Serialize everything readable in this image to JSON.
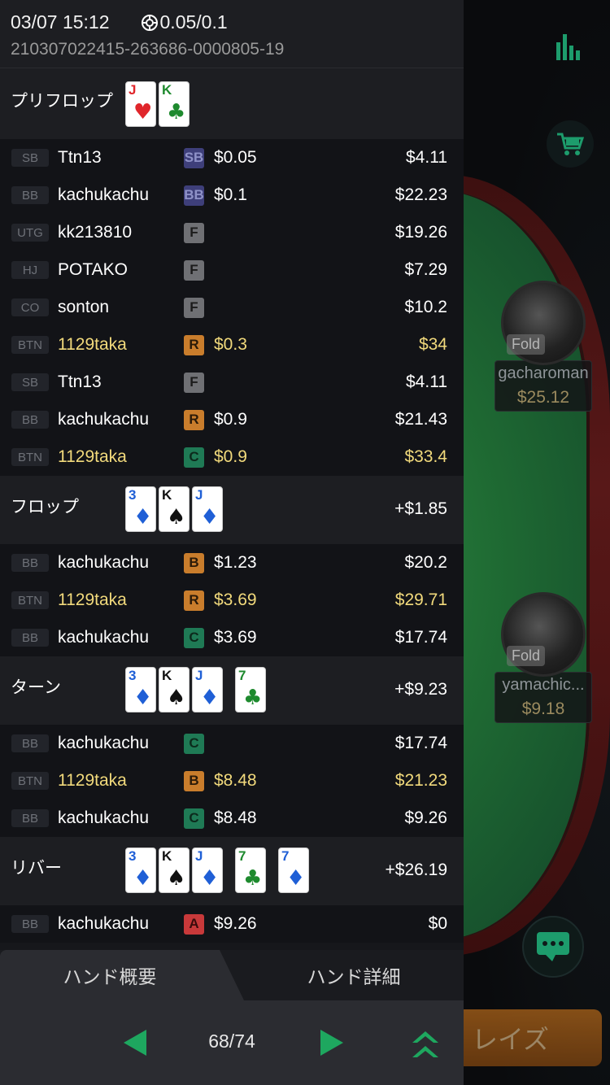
{
  "header": {
    "datetime": "03/07 15:12",
    "blinds": "0.05/0.1",
    "hand_id": "210307022415-263686-0000805-19"
  },
  "preflop": {
    "title": "プリフロップ",
    "cards": [
      {
        "rank": "J",
        "suit": "♥",
        "color": "#e0262b"
      },
      {
        "rank": "K",
        "suit": "♣",
        "color": "#1e8a2e"
      }
    ],
    "rows": [
      {
        "pos": "SB",
        "name": "Ttn13",
        "act": "SB",
        "amount": "$0.05",
        "stack": "$4.11",
        "hero": false
      },
      {
        "pos": "BB",
        "name": "kachukachu",
        "act": "BB",
        "amount": "$0.1",
        "stack": "$22.23",
        "hero": false
      },
      {
        "pos": "UTG",
        "name": "kk213810",
        "act": "F",
        "amount": "",
        "stack": "$19.26",
        "hero": false
      },
      {
        "pos": "HJ",
        "name": "POTAKO",
        "act": "F",
        "amount": "",
        "stack": "$7.29",
        "hero": false
      },
      {
        "pos": "CO",
        "name": "sonton",
        "act": "F",
        "amount": "",
        "stack": "$10.2",
        "hero": false
      },
      {
        "pos": "BTN",
        "name": "1129taka",
        "act": "R",
        "amount": "$0.3",
        "stack": "$34",
        "hero": true
      },
      {
        "pos": "SB",
        "name": "Ttn13",
        "act": "F",
        "amount": "",
        "stack": "$4.11",
        "hero": false
      },
      {
        "pos": "BB",
        "name": "kachukachu",
        "act": "R",
        "amount": "$0.9",
        "stack": "$21.43",
        "hero": false
      },
      {
        "pos": "BTN",
        "name": "1129taka",
        "act": "C",
        "amount": "$0.9",
        "stack": "$33.4",
        "hero": true
      }
    ]
  },
  "flop": {
    "title": "フロップ",
    "pot": "+$1.85",
    "cards": [
      {
        "rank": "3",
        "suit": "♦",
        "color": "#1f5fd6"
      },
      {
        "rank": "K",
        "suit": "♠",
        "color": "#111111"
      },
      {
        "rank": "J",
        "suit": "♦",
        "color": "#1f5fd6"
      }
    ],
    "rows": [
      {
        "pos": "BB",
        "name": "kachukachu",
        "act": "B",
        "amount": "$1.23",
        "stack": "$20.2",
        "hero": false
      },
      {
        "pos": "BTN",
        "name": "1129taka",
        "act": "R",
        "amount": "$3.69",
        "stack": "$29.71",
        "hero": true
      },
      {
        "pos": "BB",
        "name": "kachukachu",
        "act": "C",
        "amount": "$3.69",
        "stack": "$17.74",
        "hero": false
      }
    ]
  },
  "turn": {
    "title": "ターン",
    "pot": "+$9.23",
    "cards": [
      {
        "rank": "3",
        "suit": "♦",
        "color": "#1f5fd6"
      },
      {
        "rank": "K",
        "suit": "♠",
        "color": "#111111"
      },
      {
        "rank": "J",
        "suit": "♦",
        "color": "#1f5fd6"
      },
      {
        "rank": "7",
        "suit": "♣",
        "color": "#1e8a2e"
      }
    ],
    "rows": [
      {
        "pos": "BB",
        "name": "kachukachu",
        "act": "C",
        "amount": "",
        "stack": "$17.74",
        "hero": false
      },
      {
        "pos": "BTN",
        "name": "1129taka",
        "act": "B",
        "amount": "$8.48",
        "stack": "$21.23",
        "hero": true
      },
      {
        "pos": "BB",
        "name": "kachukachu",
        "act": "C",
        "amount": "$8.48",
        "stack": "$9.26",
        "hero": false
      }
    ]
  },
  "river": {
    "title": "リバー",
    "pot": "+$26.19",
    "cards": [
      {
        "rank": "3",
        "suit": "♦",
        "color": "#1f5fd6"
      },
      {
        "rank": "K",
        "suit": "♠",
        "color": "#111111"
      },
      {
        "rank": "J",
        "suit": "♦",
        "color": "#1f5fd6"
      },
      {
        "rank": "7",
        "suit": "♣",
        "color": "#1e8a2e"
      },
      {
        "rank": "7",
        "suit": "♦",
        "color": "#1f5fd6"
      }
    ],
    "rows": [
      {
        "pos": "BB",
        "name": "kachukachu",
        "act": "A",
        "amount": "$9.26",
        "stack": "$0",
        "hero": false
      }
    ]
  },
  "action_colors": {
    "SB": "#3e3f7a",
    "BB": "#3e3f7a",
    "F": "#6f7074",
    "R": "#c97d2c",
    "C": "#1f7a55",
    "B": "#c97d2c",
    "A": "#c8393a"
  },
  "action_text_colors": {
    "SB": "#8f92c8",
    "BB": "#8f92c8",
    "F": "#1b1b1b",
    "R": "#2a1a08",
    "C": "#0c2a1c",
    "B": "#2a1a08",
    "A": "#3a0c0c"
  },
  "tabs": {
    "summary": "ハンド概要",
    "detail": "ハンド詳細"
  },
  "nav": {
    "page": "68/74"
  },
  "table": {
    "seat1": {
      "name": "gacharoman",
      "stack": "$25.12",
      "status": "Fold"
    },
    "seat2": {
      "name": "yamachic...",
      "stack": "$9.18",
      "status": "Fold"
    },
    "raise_label": "レイズ"
  }
}
